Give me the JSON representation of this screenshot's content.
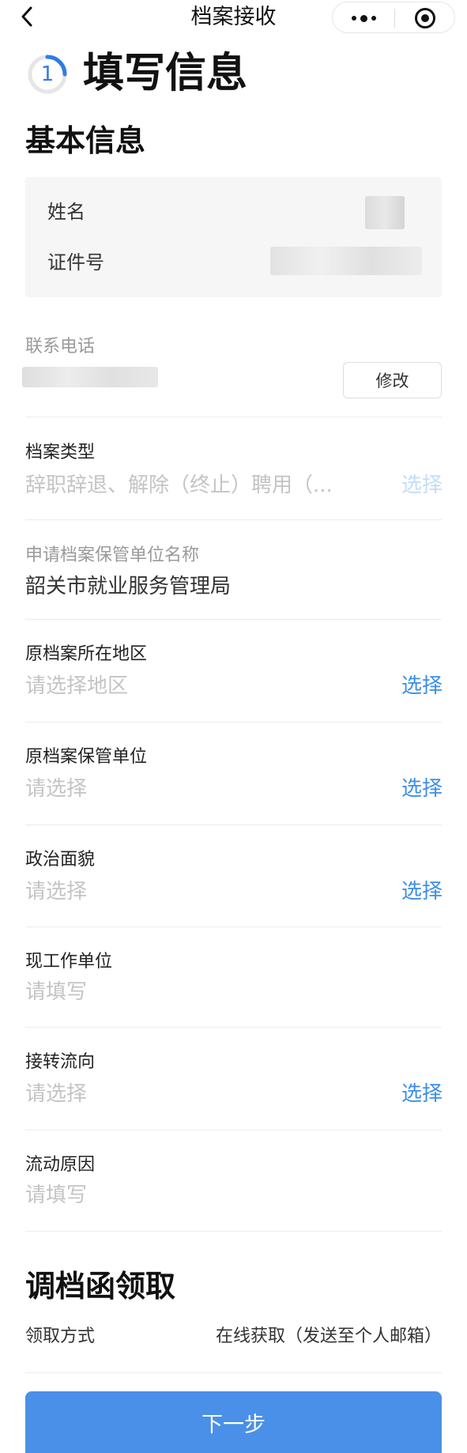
{
  "nav": {
    "title": "档案接收",
    "back_icon": "chevron-left-icon",
    "more_icon": "more-dots-icon",
    "close_icon": "target-close-icon"
  },
  "step": {
    "number": "1",
    "title": "填写信息"
  },
  "basic_info": {
    "heading": "基本信息",
    "name_label": "姓名",
    "id_label": "证件号"
  },
  "contact": {
    "label": "联系电话",
    "modify_label": "修改"
  },
  "fields": [
    {
      "label": "档案类型",
      "value": "辞职辞退、解除（终止）聘用（...",
      "action": "选择"
    },
    {
      "label": "申请档案保管单位名称",
      "value": "韶关市就业服务管理局"
    },
    {
      "label": "原档案所在地区",
      "placeholder": "请选择地区",
      "action": "选择"
    },
    {
      "label": "原档案保管单位",
      "placeholder": "请选择",
      "action": "选择"
    },
    {
      "label": "政治面貌",
      "placeholder": "请选择",
      "action": "选择"
    },
    {
      "label": "现工作单位",
      "placeholder": "请填写"
    },
    {
      "label": "接转流向",
      "placeholder": "请选择",
      "action": "选择"
    },
    {
      "label": "流动原因",
      "placeholder": "请填写"
    }
  ],
  "letter": {
    "heading": "调档函领取",
    "method_label": "领取方式",
    "method_value": "在线获取（发送至个人邮箱）"
  },
  "footer": {
    "next_label": "下一步"
  },
  "colors": {
    "accent": "#3d8ee8",
    "button": "#4a90e8",
    "placeholder": "#c4c4c4",
    "card_bg": "#f6f6f6"
  }
}
